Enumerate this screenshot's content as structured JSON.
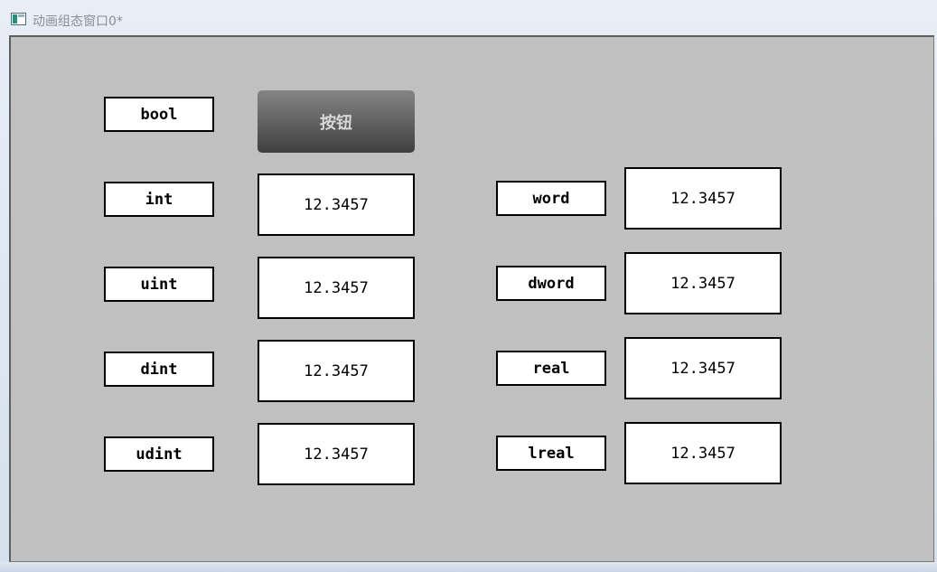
{
  "window": {
    "title": "动画组态窗口0*"
  },
  "button": {
    "label": "按钮"
  },
  "left_column": [
    {
      "label": "bool"
    },
    {
      "label": "int",
      "value": "12.3457"
    },
    {
      "label": "uint",
      "value": "12.3457"
    },
    {
      "label": "dint",
      "value": "12.3457"
    },
    {
      "label": "udint",
      "value": "12.3457"
    }
  ],
  "right_column": [
    {
      "label": "word",
      "value": "12.3457"
    },
    {
      "label": "dword",
      "value": "12.3457"
    },
    {
      "label": "real",
      "value": "12.3457"
    },
    {
      "label": "lreal",
      "value": "12.3457"
    }
  ],
  "colors": {
    "canvas": "#c0c0c0",
    "button_top": "#858585",
    "button_bottom": "#3f3f3f",
    "button_text": "#d8d8d8"
  },
  "icons": {
    "title_icon": "window-app-icon"
  }
}
